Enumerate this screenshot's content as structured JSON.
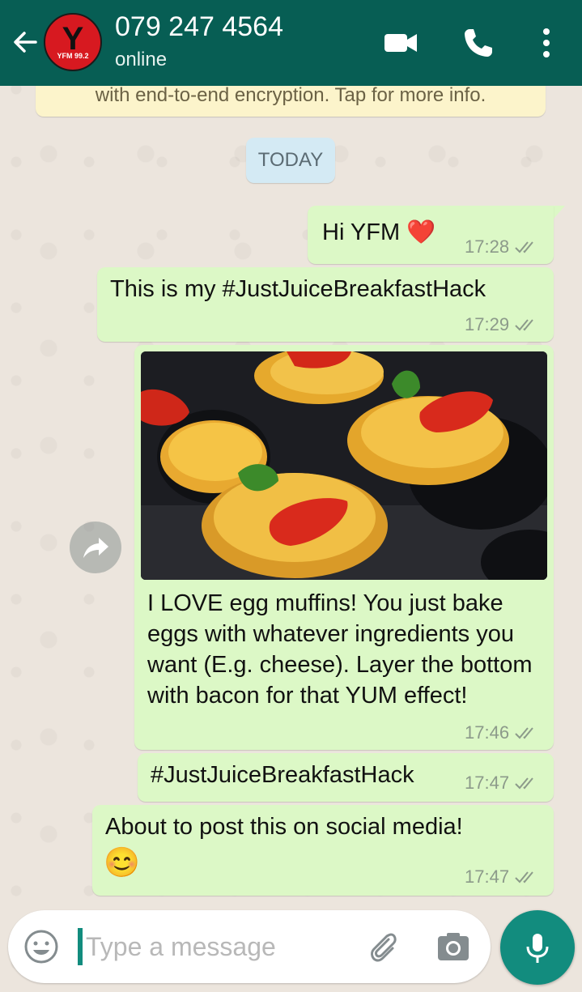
{
  "header": {
    "contact_name": "079 247 4564",
    "status": "online",
    "avatar_text": "Y",
    "avatar_sub": "YFM 99.2",
    "icons": [
      "back-arrow-icon",
      "video-call-icon",
      "voice-call-icon",
      "more-options-icon"
    ]
  },
  "encryption_notice": "with end-to-end encryption. Tap for more info.",
  "date_chip": "TODAY",
  "messages": [
    {
      "text": "Hi YFM ❤️",
      "time": "17:28",
      "status": "read"
    },
    {
      "text": "This is my #JustJuiceBreakfastHack",
      "time": "17:29",
      "status": "read"
    },
    {
      "text": "I LOVE egg muffins! You just bake eggs with whatever ingredients you want (E.g. cheese).  Layer the bottom with bacon for that YUM effect!",
      "time": "17:46",
      "status": "read",
      "has_image": true
    },
    {
      "text": "#JustJuiceBreakfastHack",
      "time": "17:47",
      "status": "read"
    },
    {
      "text": "About to post this on social media!",
      "emoji": "😊",
      "time": "17:47",
      "status": "read"
    }
  ],
  "composer": {
    "placeholder": "Type a message",
    "value": ""
  },
  "colors": {
    "header": "#075e54",
    "outgoing_bubble": "#dcf8c6",
    "accent": "#128c7e",
    "notice": "#fcf4cb",
    "date_chip": "#d4eaf4"
  }
}
